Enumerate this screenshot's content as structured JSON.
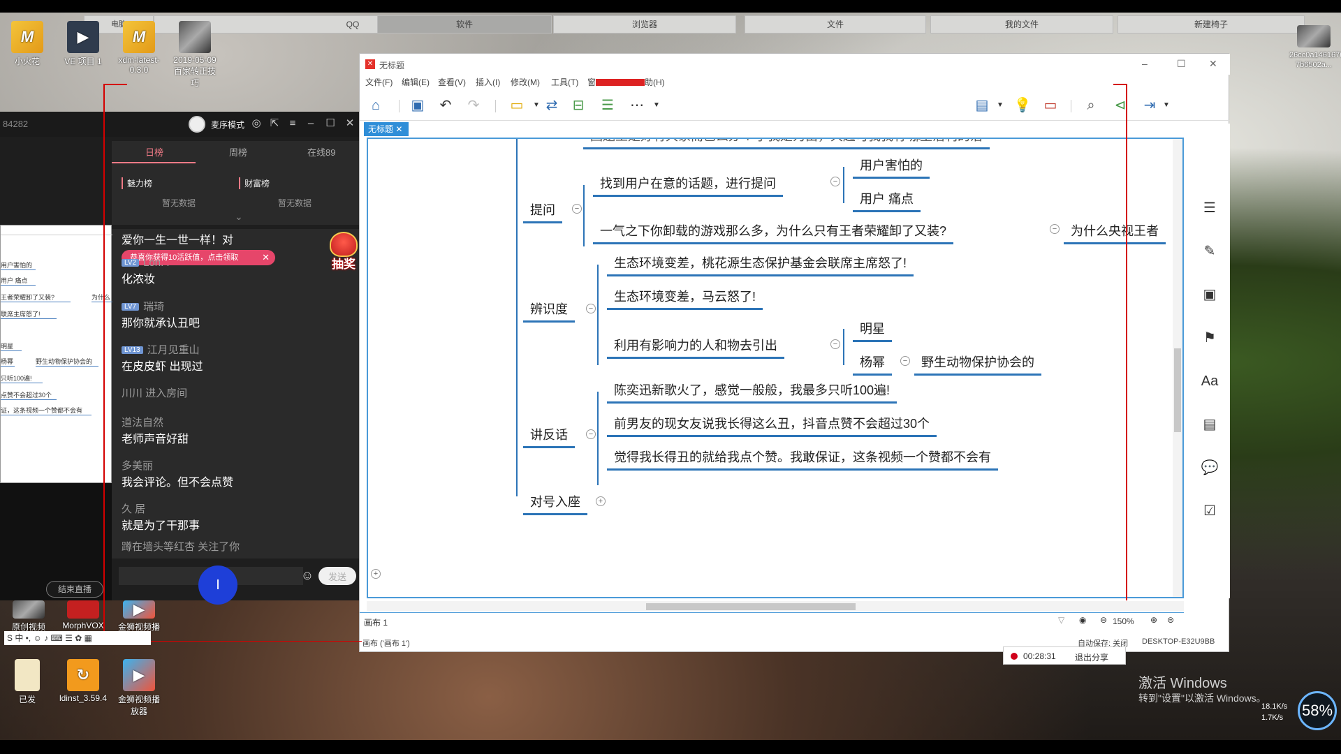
{
  "top_tabs": [
    "QQ",
    "软件",
    "浏览器",
    "文件",
    "我的文件",
    "新建椅子"
  ],
  "top_tab_small": "电脑",
  "desktop_icons": {
    "xiaohuohua": "小火花",
    "ve": "VE 项目 1",
    "xdm": "xdm-latest-0.3.0",
    "photo": "2019-05-09 百家转正技巧",
    "yuanchuang": "原创视频",
    "morphvox": "MorphVOX",
    "jinshan": "金狮视频播放",
    "yifa": "已发",
    "ldinst": "ldinst_3.59.4",
    "jinshan2": "金狮视频播放器",
    "rightfile": "26cc0a1461676 7b6502a..."
  },
  "live": {
    "room_id": "84282",
    "mode_label": "麦序模式",
    "tabs": [
      "日榜",
      "周榜",
      "在线89"
    ],
    "board_charm": "魅力榜",
    "board_wealth": "财富榜",
    "no_data": "暂无数据",
    "messages": [
      {
        "name": "",
        "text": "爱你一生一世一样！对"
      },
      {
        "lv": "LV2",
        "name": "Lon. .",
        "text": "化浓妆"
      },
      {
        "lv": "LV7",
        "name": "瑞琦",
        "text": "那你就承认丑吧"
      },
      {
        "lv": "LV13",
        "name": "江月见重山",
        "text": "在皮皮虾 出现过"
      },
      {
        "name": "",
        "text": "川川 进入房间"
      },
      {
        "name": "道法自然",
        "text": "老师声音好甜"
      },
      {
        "name": "多美丽",
        "text": "我会评论。但不会点赞"
      },
      {
        "name": "久 居",
        "text": "就是为了干那事"
      },
      {
        "name": "",
        "text": "蹲在墙头等红杏 关注了你"
      }
    ],
    "reward_pill": "恭喜你获得10活跃值，点击领取",
    "lottery": "抽奖",
    "send": "发送",
    "end_live": "结束直播"
  },
  "mini_map": [
    "用户害怕的",
    "用户 痛点",
    "王者荣耀卸了又装?",
    "为什么",
    "联席主席怒了!",
    "明星",
    "杨幂",
    "野生动物保护协会的",
    "只听100遍!",
    "点赞不会超过30个",
    "证，这条视频一个赞都不会有"
  ],
  "xmind": {
    "title": "无标题",
    "menu": [
      "文件(F)",
      "编辑(E)",
      "查看(V)",
      "插入(I)",
      "修改(M)",
      "工具(T)",
      "窗",
      "助(H)"
    ],
    "doc_tab": "无标题",
    "sheet": "画布 1",
    "status_left": "画布 ('画布 1')",
    "autosave": "自动保存: 关闭",
    "computer": "DESKTOP-E32U9BB",
    "zoom": "150%",
    "map": {
      "top_cut": "回题王是好有大家而已么办 ? 子我是为由，大起可我我有 那",
      "top_cut_right": "主治利的治",
      "tiwen": "提问",
      "tiwen_1": "找到用户在意的话题，进行提问",
      "tiwen_1a": "用户害怕的",
      "tiwen_1b": "用户 痛点",
      "tiwen_2": "一气之下你卸载的游戏那么多，为什么只有王者荣耀卸了又装?",
      "tiwen_2a": "为什么央视王者",
      "bianshi": "辨识度",
      "bianshi_1": "生态环境变差，桃花源生态保护基金会联席主席怒了!",
      "bianshi_2": "生态环境变差，马云怒了!",
      "bianshi_3": "利用有影响力的人和物去引出",
      "bianshi_3a": "明星",
      "bianshi_3b": "杨幂",
      "bianshi_3b1": "野生动物保护协会的",
      "jiangfan": "讲反话",
      "jiangfan_1": "陈奕迅新歌火了，感觉一般般，我最多只听100遍!",
      "jiangfan_2": "前男友的现女友说我长得这么丑，抖音点赞不会超过30个",
      "jiangfan_3": "觉得我长得丑的就给我点个赞。我敢保证，这条视频一个赞都不会有",
      "duihao": "对号入座"
    }
  },
  "recording": {
    "time": "00:28:31",
    "stop": "退出分享"
  },
  "activate": {
    "line1": "激活 Windows",
    "line2": "转到\"设置\"以激活 Windows。"
  },
  "net": {
    "percent": "58%",
    "up": "18.1K/s",
    "down": "1.7K/s"
  },
  "colors": {
    "branch": "#2c74b7",
    "accent_pink": "#f07a86",
    "pill": "#e6466a"
  }
}
